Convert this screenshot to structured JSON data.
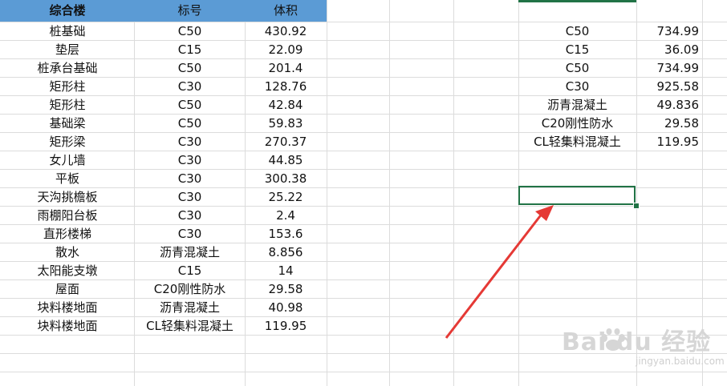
{
  "left_table": {
    "headers": [
      "综合楼",
      "标号",
      "体积"
    ],
    "rows": [
      [
        "桩基础",
        "C50",
        "430.92"
      ],
      [
        "垫层",
        "C15",
        "22.09"
      ],
      [
        "桩承台基础",
        "C50",
        "201.4"
      ],
      [
        "矩形柱",
        "C30",
        "128.76"
      ],
      [
        "矩形柱",
        "C50",
        "42.84"
      ],
      [
        "基础梁",
        "C50",
        "59.83"
      ],
      [
        "矩形梁",
        "C30",
        "270.37"
      ],
      [
        "女儿墙",
        "C30",
        "44.85"
      ],
      [
        "平板",
        "C30",
        "300.38"
      ],
      [
        "天沟挑檐板",
        "C30",
        "25.22"
      ],
      [
        "雨棚阳台板",
        "C30",
        "2.4"
      ],
      [
        "直形楼梯",
        "C30",
        "153.6"
      ],
      [
        "散水",
        "沥青混凝土",
        "8.856"
      ],
      [
        "太阳能支墩",
        "C15",
        "14"
      ],
      [
        "屋面",
        "C20刚性防水",
        "29.58"
      ],
      [
        "块料楼地面",
        "沥青混凝土",
        "40.98"
      ],
      [
        "块料楼地面",
        "CL轻集料混凝土",
        "119.95"
      ]
    ]
  },
  "right_table": {
    "rows": [
      [
        "C50",
        "734.99"
      ],
      [
        "C15",
        "36.09"
      ],
      [
        "C50",
        "734.99"
      ],
      [
        "C30",
        "925.58"
      ],
      [
        "沥青混凝土",
        "49.836"
      ],
      [
        "C20刚性防水",
        "29.58"
      ],
      [
        "CL轻集料混凝土",
        "119.95"
      ]
    ]
  },
  "watermark": {
    "text": "Bai du 经验",
    "sub": "jingyan.baidu.com"
  },
  "colors": {
    "header_bg": "#5b9bd5",
    "selection": "#217346",
    "arrow": "#e53935",
    "grid": "#dcdcdc"
  }
}
